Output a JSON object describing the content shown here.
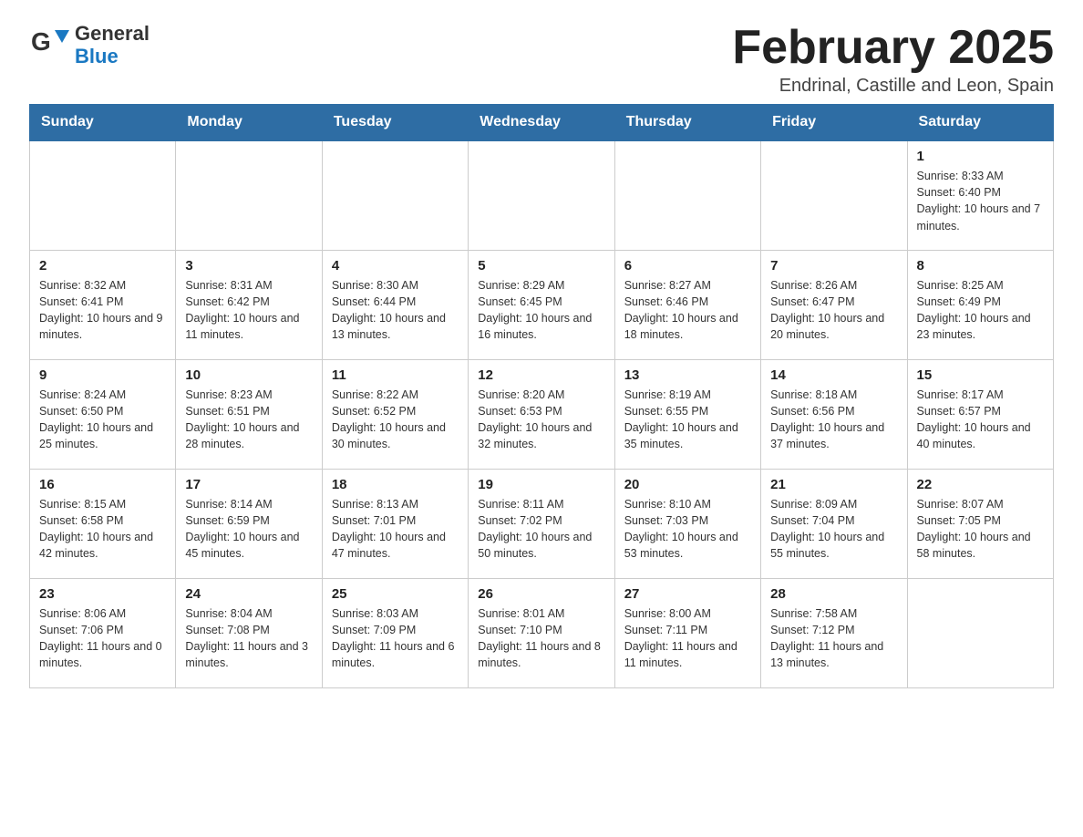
{
  "header": {
    "logo_line1": "General",
    "logo_line2": "Blue",
    "title": "February 2025",
    "subtitle": "Endrinal, Castille and Leon, Spain"
  },
  "days_of_week": [
    "Sunday",
    "Monday",
    "Tuesday",
    "Wednesday",
    "Thursday",
    "Friday",
    "Saturday"
  ],
  "weeks": [
    [
      {
        "day": "",
        "info": ""
      },
      {
        "day": "",
        "info": ""
      },
      {
        "day": "",
        "info": ""
      },
      {
        "day": "",
        "info": ""
      },
      {
        "day": "",
        "info": ""
      },
      {
        "day": "",
        "info": ""
      },
      {
        "day": "1",
        "info": "Sunrise: 8:33 AM\nSunset: 6:40 PM\nDaylight: 10 hours and 7 minutes."
      }
    ],
    [
      {
        "day": "2",
        "info": "Sunrise: 8:32 AM\nSunset: 6:41 PM\nDaylight: 10 hours and 9 minutes."
      },
      {
        "day": "3",
        "info": "Sunrise: 8:31 AM\nSunset: 6:42 PM\nDaylight: 10 hours and 11 minutes."
      },
      {
        "day": "4",
        "info": "Sunrise: 8:30 AM\nSunset: 6:44 PM\nDaylight: 10 hours and 13 minutes."
      },
      {
        "day": "5",
        "info": "Sunrise: 8:29 AM\nSunset: 6:45 PM\nDaylight: 10 hours and 16 minutes."
      },
      {
        "day": "6",
        "info": "Sunrise: 8:27 AM\nSunset: 6:46 PM\nDaylight: 10 hours and 18 minutes."
      },
      {
        "day": "7",
        "info": "Sunrise: 8:26 AM\nSunset: 6:47 PM\nDaylight: 10 hours and 20 minutes."
      },
      {
        "day": "8",
        "info": "Sunrise: 8:25 AM\nSunset: 6:49 PM\nDaylight: 10 hours and 23 minutes."
      }
    ],
    [
      {
        "day": "9",
        "info": "Sunrise: 8:24 AM\nSunset: 6:50 PM\nDaylight: 10 hours and 25 minutes."
      },
      {
        "day": "10",
        "info": "Sunrise: 8:23 AM\nSunset: 6:51 PM\nDaylight: 10 hours and 28 minutes."
      },
      {
        "day": "11",
        "info": "Sunrise: 8:22 AM\nSunset: 6:52 PM\nDaylight: 10 hours and 30 minutes."
      },
      {
        "day": "12",
        "info": "Sunrise: 8:20 AM\nSunset: 6:53 PM\nDaylight: 10 hours and 32 minutes."
      },
      {
        "day": "13",
        "info": "Sunrise: 8:19 AM\nSunset: 6:55 PM\nDaylight: 10 hours and 35 minutes."
      },
      {
        "day": "14",
        "info": "Sunrise: 8:18 AM\nSunset: 6:56 PM\nDaylight: 10 hours and 37 minutes."
      },
      {
        "day": "15",
        "info": "Sunrise: 8:17 AM\nSunset: 6:57 PM\nDaylight: 10 hours and 40 minutes."
      }
    ],
    [
      {
        "day": "16",
        "info": "Sunrise: 8:15 AM\nSunset: 6:58 PM\nDaylight: 10 hours and 42 minutes."
      },
      {
        "day": "17",
        "info": "Sunrise: 8:14 AM\nSunset: 6:59 PM\nDaylight: 10 hours and 45 minutes."
      },
      {
        "day": "18",
        "info": "Sunrise: 8:13 AM\nSunset: 7:01 PM\nDaylight: 10 hours and 47 minutes."
      },
      {
        "day": "19",
        "info": "Sunrise: 8:11 AM\nSunset: 7:02 PM\nDaylight: 10 hours and 50 minutes."
      },
      {
        "day": "20",
        "info": "Sunrise: 8:10 AM\nSunset: 7:03 PM\nDaylight: 10 hours and 53 minutes."
      },
      {
        "day": "21",
        "info": "Sunrise: 8:09 AM\nSunset: 7:04 PM\nDaylight: 10 hours and 55 minutes."
      },
      {
        "day": "22",
        "info": "Sunrise: 8:07 AM\nSunset: 7:05 PM\nDaylight: 10 hours and 58 minutes."
      }
    ],
    [
      {
        "day": "23",
        "info": "Sunrise: 8:06 AM\nSunset: 7:06 PM\nDaylight: 11 hours and 0 minutes."
      },
      {
        "day": "24",
        "info": "Sunrise: 8:04 AM\nSunset: 7:08 PM\nDaylight: 11 hours and 3 minutes."
      },
      {
        "day": "25",
        "info": "Sunrise: 8:03 AM\nSunset: 7:09 PM\nDaylight: 11 hours and 6 minutes."
      },
      {
        "day": "26",
        "info": "Sunrise: 8:01 AM\nSunset: 7:10 PM\nDaylight: 11 hours and 8 minutes."
      },
      {
        "day": "27",
        "info": "Sunrise: 8:00 AM\nSunset: 7:11 PM\nDaylight: 11 hours and 11 minutes."
      },
      {
        "day": "28",
        "info": "Sunrise: 7:58 AM\nSunset: 7:12 PM\nDaylight: 11 hours and 13 minutes."
      },
      {
        "day": "",
        "info": ""
      }
    ]
  ]
}
